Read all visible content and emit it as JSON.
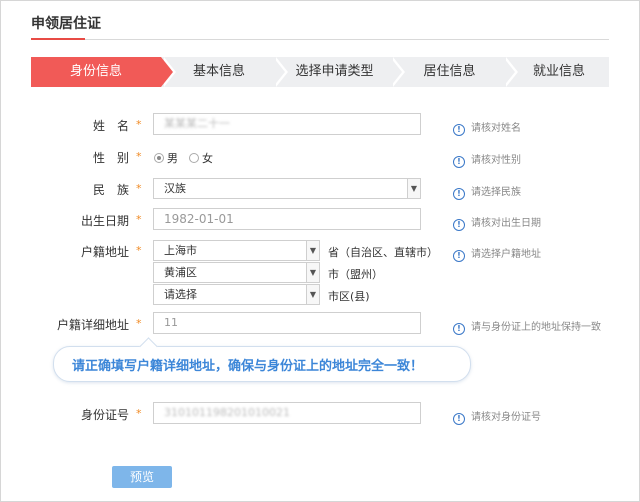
{
  "page": {
    "title": "申领居住证"
  },
  "steps": [
    {
      "label": "身份信息",
      "active": true
    },
    {
      "label": "基本信息",
      "active": false
    },
    {
      "label": "选择申请类型",
      "active": false
    },
    {
      "label": "居住信息",
      "active": false
    },
    {
      "label": "就业信息",
      "active": false
    }
  ],
  "form": {
    "required_mark": "*",
    "name": {
      "label": "姓　名",
      "value": "某某某二十一",
      "hint": "请核对姓名"
    },
    "gender": {
      "label": "性　别",
      "options": [
        "男",
        "女"
      ],
      "selected": "男",
      "hint": "请核对性别"
    },
    "ethnicity": {
      "label": "民　族",
      "value": "汉族",
      "hint": "请选择民族"
    },
    "birthdate": {
      "label": "出生日期",
      "value": "1982-01-01",
      "hint": "请核对出生日期"
    },
    "household": {
      "label": "户籍地址",
      "province": "上海市",
      "province_suffix": "省（自治区、直辖市）",
      "city": "黄浦区",
      "city_suffix": "市（盟州）",
      "district": "请选择",
      "district_suffix": "市区(县)",
      "hint": "请选择户籍地址"
    },
    "household_detail": {
      "label": "户籍详细地址",
      "value": "11",
      "hint": "请与身份证上的地址保持一致"
    },
    "tooltip": "请正确填写户籍详细地址，确保与身份证上的地址完全一致！",
    "id_number": {
      "label": "身份证号",
      "value": "310101198201010021",
      "hint": "请核对身份证号"
    }
  },
  "actions": {
    "preview_label": "预览"
  },
  "colors": {
    "accent": "#f15a57",
    "step_bg": "#eeeff1",
    "required": "#f08a24",
    "hint_icon": "#3a78c8",
    "tooltip_text": "#3c86d8",
    "button": "#7eb6ea"
  },
  "icons": {
    "hint": "info-circle-icon",
    "select": "chevron-down-icon"
  }
}
